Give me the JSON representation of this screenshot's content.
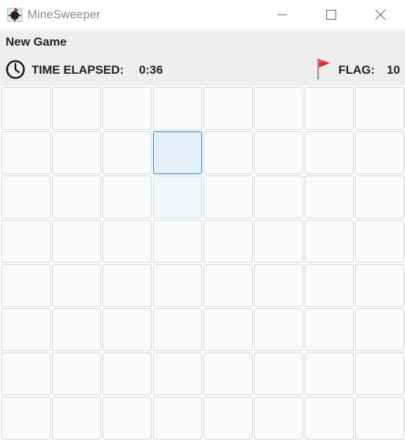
{
  "window": {
    "title": "MineSweeper",
    "icon": "minesweeper-app-icon",
    "controls": [
      "minimize",
      "maximize",
      "close"
    ]
  },
  "menu": {
    "new_game_label": "New Game"
  },
  "status": {
    "time_label": "TIME ELAPSED:",
    "time_value": "0:36",
    "time_icon": "clock-icon",
    "flag_label": "FLAG:",
    "flag_value": "10",
    "flag_icon": "red-flag-icon"
  },
  "board": {
    "rows": 8,
    "cols": 8,
    "highlighted_cells": [
      {
        "row": 1,
        "col": 3,
        "state": "hovered"
      },
      {
        "row": 2,
        "col": 3,
        "state": "pressed"
      }
    ]
  },
  "colors": {
    "hover_border": "#1a7bd0",
    "hover_fill": "#e6f0fa",
    "flag": "#e62828"
  }
}
